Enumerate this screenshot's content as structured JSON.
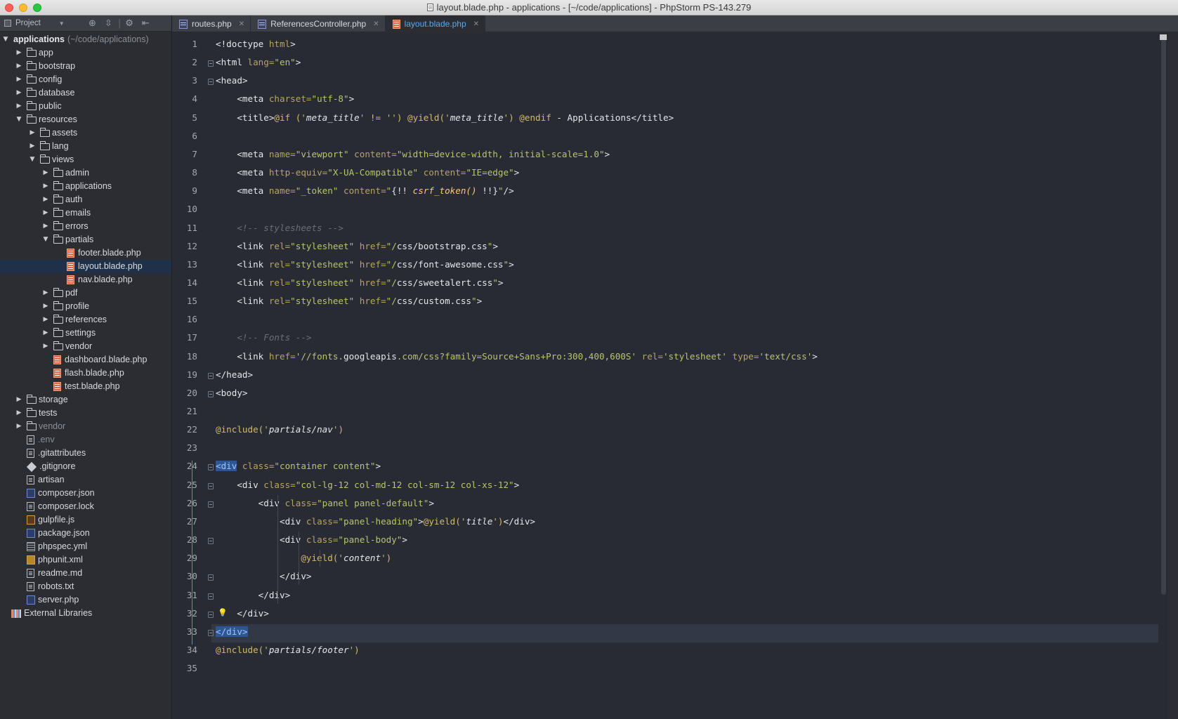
{
  "window": {
    "title": "layout.blade.php - applications - [~/code/applications] - PhpStorm PS-143.279"
  },
  "project_panel": {
    "view_label": "Project",
    "toolbar_icons": [
      "target-icon",
      "collapse-icon",
      "gear-icon",
      "hide-icon"
    ],
    "tree": [
      {
        "label": "applications",
        "extra": "(~/code/applications)",
        "type": "root",
        "depth": 0,
        "expanded": true
      },
      {
        "label": "app",
        "type": "folder",
        "depth": 1,
        "expanded": false
      },
      {
        "label": "bootstrap",
        "type": "folder",
        "depth": 1,
        "expanded": false
      },
      {
        "label": "config",
        "type": "folder",
        "depth": 1,
        "expanded": false
      },
      {
        "label": "database",
        "type": "folder",
        "depth": 1,
        "expanded": false
      },
      {
        "label": "public",
        "type": "folder",
        "depth": 1,
        "expanded": false
      },
      {
        "label": "resources",
        "type": "folder",
        "depth": 1,
        "expanded": true
      },
      {
        "label": "assets",
        "type": "folder",
        "depth": 2,
        "expanded": false
      },
      {
        "label": "lang",
        "type": "folder",
        "depth": 2,
        "expanded": false
      },
      {
        "label": "views",
        "type": "folder",
        "depth": 2,
        "expanded": true
      },
      {
        "label": "admin",
        "type": "folder",
        "depth": 3,
        "expanded": false
      },
      {
        "label": "applications",
        "type": "folder",
        "depth": 3,
        "expanded": false
      },
      {
        "label": "auth",
        "type": "folder",
        "depth": 3,
        "expanded": false
      },
      {
        "label": "emails",
        "type": "folder",
        "depth": 3,
        "expanded": false
      },
      {
        "label": "errors",
        "type": "folder",
        "depth": 3,
        "expanded": false
      },
      {
        "label": "partials",
        "type": "folder",
        "depth": 3,
        "expanded": true
      },
      {
        "label": "footer.blade.php",
        "type": "blade",
        "depth": 4
      },
      {
        "label": "layout.blade.php",
        "type": "blade",
        "depth": 4,
        "selected": true
      },
      {
        "label": "nav.blade.php",
        "type": "blade",
        "depth": 4
      },
      {
        "label": "pdf",
        "type": "folder",
        "depth": 3,
        "expanded": false
      },
      {
        "label": "profile",
        "type": "folder",
        "depth": 3,
        "expanded": false
      },
      {
        "label": "references",
        "type": "folder",
        "depth": 3,
        "expanded": false
      },
      {
        "label": "settings",
        "type": "folder",
        "depth": 3,
        "expanded": false
      },
      {
        "label": "vendor",
        "type": "folder",
        "depth": 3,
        "expanded": false
      },
      {
        "label": "dashboard.blade.php",
        "type": "blade",
        "depth": 3
      },
      {
        "label": "flash.blade.php",
        "type": "blade",
        "depth": 3
      },
      {
        "label": "test.blade.php",
        "type": "blade",
        "depth": 3
      },
      {
        "label": "storage",
        "type": "folder",
        "depth": 1,
        "expanded": false
      },
      {
        "label": "tests",
        "type": "folder",
        "depth": 1,
        "expanded": false
      },
      {
        "label": "vendor",
        "type": "folder",
        "depth": 1,
        "expanded": false,
        "dim": true
      },
      {
        "label": ".env",
        "type": "file",
        "depth": 1,
        "dim": true
      },
      {
        "label": ".gitattributes",
        "type": "file",
        "depth": 1
      },
      {
        "label": ".gitignore",
        "type": "git",
        "depth": 1
      },
      {
        "label": "artisan",
        "type": "file",
        "depth": 1
      },
      {
        "label": "composer.json",
        "type": "json",
        "depth": 1
      },
      {
        "label": "composer.lock",
        "type": "file",
        "depth": 1
      },
      {
        "label": "gulpfile.js",
        "type": "js",
        "depth": 1
      },
      {
        "label": "package.json",
        "type": "json",
        "depth": 1
      },
      {
        "label": "phpspec.yml",
        "type": "yml",
        "depth": 1
      },
      {
        "label": "phpunit.xml",
        "type": "xml",
        "depth": 1
      },
      {
        "label": "readme.md",
        "type": "file",
        "depth": 1
      },
      {
        "label": "robots.txt",
        "type": "file",
        "depth": 1
      },
      {
        "label": "server.php",
        "type": "json",
        "depth": 1
      },
      {
        "label": "External Libraries",
        "type": "lib",
        "depth": 0
      }
    ]
  },
  "tabs": [
    {
      "label": "routes.php",
      "active": false
    },
    {
      "label": "ReferencesController.php",
      "active": false
    },
    {
      "label": "layout.blade.php",
      "active": true
    }
  ],
  "editor": {
    "current_line": 33,
    "line_numbers": [
      "1",
      "2",
      "3",
      "4",
      "5",
      "6",
      "7",
      "8",
      "9",
      "10",
      "11",
      "12",
      "13",
      "14",
      "15",
      "16",
      "17",
      "18",
      "19",
      "20",
      "21",
      "22",
      "23",
      "24",
      "25",
      "26",
      "27",
      "28",
      "29",
      "30",
      "31",
      "32",
      "33",
      "34",
      "35"
    ],
    "lines": [
      [
        [
          "t-ang",
          "<!doctype "
        ],
        [
          "t-attr",
          "html"
        ],
        [
          "t-ang",
          ">"
        ]
      ],
      [
        [
          "t-ang",
          "<html "
        ],
        [
          "t-attr",
          "lang="
        ],
        [
          "t-str",
          "\"en\""
        ],
        [
          "t-ang",
          ">"
        ]
      ],
      [
        [
          "t-ang",
          "<head>"
        ]
      ],
      [
        [
          "t-ang",
          "    <meta "
        ],
        [
          "t-attr",
          "charset="
        ],
        [
          "t-str",
          "\"utf-8\""
        ],
        [
          "t-ang",
          ">"
        ]
      ],
      [
        [
          "t-ang",
          "    <title>"
        ],
        [
          "t-kw",
          "@if ("
        ],
        [
          "t-str",
          "'"
        ],
        [
          "t-it",
          "meta_title"
        ],
        [
          "t-str",
          "'"
        ],
        [
          "t-kw",
          " != "
        ],
        [
          "t-str",
          "''"
        ],
        [
          "t-kw",
          ") @yield("
        ],
        [
          "t-str",
          "'"
        ],
        [
          "t-it",
          "meta_title"
        ],
        [
          "t-str",
          "'"
        ],
        [
          "t-kw",
          ") @endif "
        ],
        [
          "t-ang",
          "- Applications</title>"
        ]
      ],
      [],
      [
        [
          "t-ang",
          "    <meta "
        ],
        [
          "t-attr",
          "name="
        ],
        [
          "t-str",
          "\"viewport\" "
        ],
        [
          "t-attr",
          "content="
        ],
        [
          "t-str",
          "\"width=device-width, initial-scale=1.0\""
        ],
        [
          "t-ang",
          ">"
        ]
      ],
      [
        [
          "t-ang",
          "    <meta "
        ],
        [
          "t-attr",
          "http-equiv="
        ],
        [
          "t-str",
          "\"X-UA-Compatible\" "
        ],
        [
          "t-attr",
          "content="
        ],
        [
          "t-str",
          "\"IE=edge\""
        ],
        [
          "t-ang",
          ">"
        ]
      ],
      [
        [
          "t-ang",
          "    <meta "
        ],
        [
          "t-attr",
          "name="
        ],
        [
          "t-str",
          "\"_token\" "
        ],
        [
          "t-attr",
          "content="
        ],
        [
          "t-str",
          "\""
        ],
        [
          "t-ang",
          "{!! "
        ],
        [
          "t-fn",
          "csrf_token()"
        ],
        [
          "t-ang",
          " !!}"
        ],
        [
          "t-str",
          "\""
        ],
        [
          "t-ang",
          "/>"
        ]
      ],
      [],
      [
        [
          "t-cm",
          "    <!-- stylesheets -->"
        ]
      ],
      [
        [
          "t-ang",
          "    <link "
        ],
        [
          "t-attr",
          "rel="
        ],
        [
          "t-str",
          "\"stylesheet\" "
        ],
        [
          "t-attr",
          "href="
        ],
        [
          "t-str",
          "\"/"
        ],
        [
          "t-url",
          "css/bootstrap.css"
        ],
        [
          "t-str",
          "\""
        ],
        [
          "t-ang",
          ">"
        ]
      ],
      [
        [
          "t-ang",
          "    <link "
        ],
        [
          "t-attr",
          "rel="
        ],
        [
          "t-str",
          "\"stylesheet\" "
        ],
        [
          "t-attr",
          "href="
        ],
        [
          "t-str",
          "\"/"
        ],
        [
          "t-url",
          "css/font-awesome.css"
        ],
        [
          "t-str",
          "\""
        ],
        [
          "t-ang",
          ">"
        ]
      ],
      [
        [
          "t-ang",
          "    <link "
        ],
        [
          "t-attr",
          "rel="
        ],
        [
          "t-str",
          "\"stylesheet\" "
        ],
        [
          "t-attr",
          "href="
        ],
        [
          "t-str",
          "\"/"
        ],
        [
          "t-url",
          "css/sweetalert.css"
        ],
        [
          "t-str",
          "\""
        ],
        [
          "t-ang",
          ">"
        ]
      ],
      [
        [
          "t-ang",
          "    <link "
        ],
        [
          "t-attr",
          "rel="
        ],
        [
          "t-str",
          "\"stylesheet\" "
        ],
        [
          "t-attr",
          "href="
        ],
        [
          "t-str",
          "\"/"
        ],
        [
          "t-url",
          "css/custom.css"
        ],
        [
          "t-str",
          "\""
        ],
        [
          "t-ang",
          ">"
        ]
      ],
      [],
      [
        [
          "t-cm",
          "    <!-- Fonts -->"
        ]
      ],
      [
        [
          "t-ang",
          "    <link "
        ],
        [
          "t-attr",
          "href="
        ],
        [
          "t-str",
          "'//fonts."
        ],
        [
          "t-url",
          "googleapis"
        ],
        [
          "t-str",
          ".com/css?family=Source+Sans+Pro:300,400,600S' "
        ],
        [
          "t-attr",
          "rel="
        ],
        [
          "t-str",
          "'stylesheet' "
        ],
        [
          "t-attr",
          "type="
        ],
        [
          "t-str",
          "'text/css'"
        ],
        [
          "t-ang",
          ">"
        ]
      ],
      [
        [
          "t-ang",
          "</head>"
        ]
      ],
      [
        [
          "t-ang",
          "<body>"
        ]
      ],
      [],
      [
        [
          "t-kw",
          "@include("
        ],
        [
          "t-str",
          "'"
        ],
        [
          "t-it",
          "partials/nav"
        ],
        [
          "t-str",
          "'"
        ],
        [
          "t-kw",
          ")"
        ]
      ],
      [],
      [
        [
          "t-sel",
          "<div"
        ],
        [
          "t-attr",
          " class="
        ],
        [
          "t-str",
          "\"container content\""
        ],
        [
          "t-ang",
          ">"
        ]
      ],
      [
        [
          "t-ang",
          "    <div "
        ],
        [
          "t-attr",
          "class="
        ],
        [
          "t-str",
          "\"col-lg-12 col-md-12 col-sm-12 col-xs-12\""
        ],
        [
          "t-ang",
          ">"
        ]
      ],
      [
        [
          "t-ang",
          "        <div "
        ],
        [
          "t-attr",
          "class="
        ],
        [
          "t-str",
          "\"panel panel-default\""
        ],
        [
          "t-ang",
          ">"
        ]
      ],
      [
        [
          "t-ang",
          "            <div "
        ],
        [
          "t-attr",
          "class="
        ],
        [
          "t-str",
          "\"panel-heading\""
        ],
        [
          "t-ang",
          ">"
        ],
        [
          "t-kw",
          "@yield("
        ],
        [
          "t-str",
          "'"
        ],
        [
          "t-it",
          "title"
        ],
        [
          "t-str",
          "'"
        ],
        [
          "t-kw",
          ")"
        ],
        [
          "t-ang",
          "</div>"
        ]
      ],
      [
        [
          "t-ang",
          "            <div "
        ],
        [
          "t-attr",
          "class="
        ],
        [
          "t-str",
          "\"panel-body\""
        ],
        [
          "t-ang",
          ">"
        ]
      ],
      [
        [
          "t-kw",
          "                @yield("
        ],
        [
          "t-str",
          "'"
        ],
        [
          "t-it",
          "content"
        ],
        [
          "t-str",
          "'"
        ],
        [
          "t-kw",
          ")"
        ]
      ],
      [
        [
          "t-ang",
          "            </div>"
        ]
      ],
      [
        [
          "t-ang",
          "        </div>"
        ]
      ],
      [
        [
          "t-ang",
          "    </div>"
        ]
      ],
      [
        [
          "t-sel",
          "</div>"
        ]
      ],
      [
        [
          "t-kw",
          "@include("
        ],
        [
          "t-str",
          "'"
        ],
        [
          "t-it",
          "partials/footer"
        ],
        [
          "t-str",
          "'"
        ],
        [
          "t-kw",
          ")"
        ]
      ],
      []
    ]
  }
}
